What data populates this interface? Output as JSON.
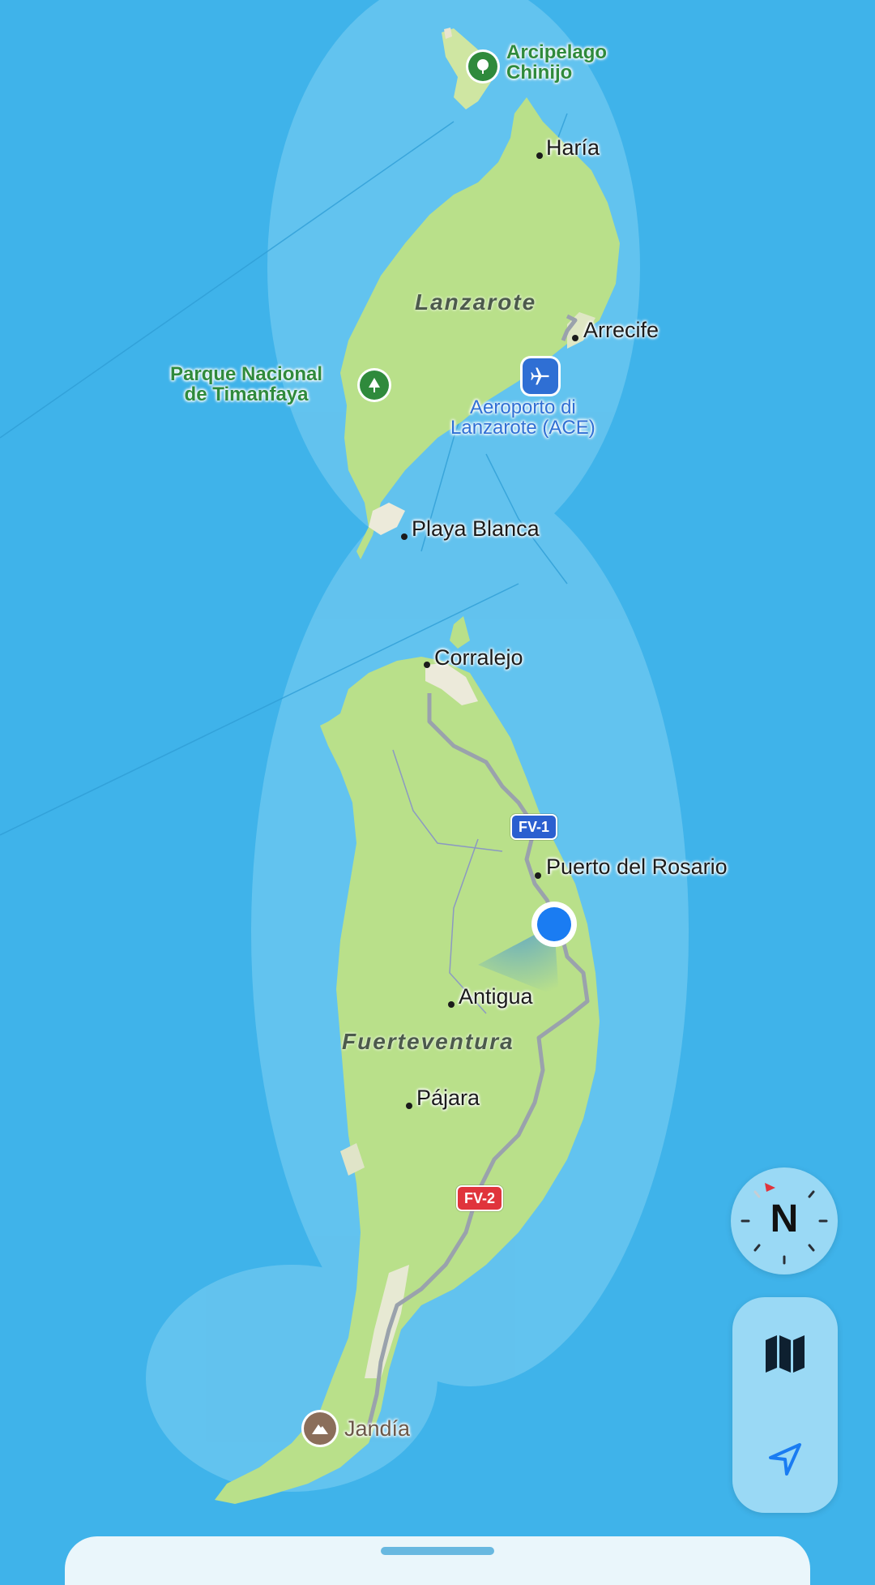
{
  "map": {
    "places": {
      "chinijo": "Arcipelago\nChinijo",
      "haria": "Haría",
      "lanzarote": "Lanzarote",
      "arrecife": "Arrecife",
      "timanfaya": "Parque Nacional\nde Timanfaya",
      "airport": "Aeroporto di\nLanzarote (ACE)",
      "playa_blanca": "Playa Blanca",
      "corralejo": "Corralejo",
      "puerto": "Puerto del Rosario",
      "antigua": "Antigua",
      "fuerteventura": "Fuerteventura",
      "pajara": "Pájara",
      "jandia": "Jandía"
    },
    "roads": {
      "fv1": "FV-1",
      "fv2": "FV-2"
    },
    "colors": {
      "sea": "#3fb3ea",
      "land": "#b9e08a",
      "park": "#2f8a3c",
      "airport": "#2f6fd4",
      "user": "#1a7cf2",
      "fv1": "#2b5fd0",
      "fv2": "#e0343c"
    }
  },
  "controls": {
    "compass_letter": "N",
    "compass_icon": "compass-icon",
    "map_icon": "map-icon",
    "location_icon": "location-arrow-icon"
  }
}
